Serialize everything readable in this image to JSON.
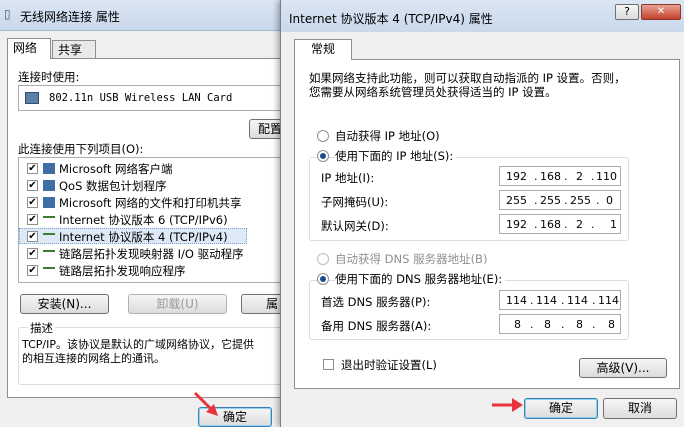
{
  "bg": {
    "title": "无线网络连接 属性",
    "tabs": [
      "网络",
      "共享"
    ],
    "connect_using_label": "连接时使用:",
    "adapter": "802.11n USB Wireless LAN Card",
    "configure_btn": "配置",
    "items_label": "此连接使用下列项目(O):",
    "items": [
      {
        "text": "Microsoft 网络客户端",
        "checked": true
      },
      {
        "text": "QoS 数据包计划程序",
        "checked": true
      },
      {
        "text": "Microsoft 网络的文件和打印机共享",
        "checked": true
      },
      {
        "text": "Internet 协议版本 6 (TCP/IPv6)",
        "checked": true
      },
      {
        "text": "Internet 协议版本 4 (TCP/IPv4)",
        "checked": true
      },
      {
        "text": "链路层拓扑发现映射器 I/O 驱动程序",
        "checked": true
      },
      {
        "text": "链路层拓扑发现响应程序",
        "checked": true
      }
    ],
    "install_btn": "安装(N)...",
    "uninstall_btn": "卸载(U)",
    "props_btn": "属",
    "desc_label": "描述",
    "desc_line1": "TCP/IP。该协议是默认的广域网络协议，它提供",
    "desc_line2": "的相互连接的网络上的通讯。",
    "ok_btn": "确定"
  },
  "fg": {
    "title": "Internet 协议版本 4 (TCP/IPv4) 属性",
    "help_btn": "?",
    "close_btn": "✕",
    "tab": "常规",
    "intro_line1": "如果网络支持此功能，则可以获取自动指派的 IP 设置。否则，",
    "intro_line2": "您需要从网络系统管理员处获得适当的 IP 设置。",
    "auto_ip": "自动获得 IP 地址(O)",
    "manual_ip": "使用下面的 IP 地址(S):",
    "ip_label": "IP 地址(I):",
    "ip": [
      "192",
      "168",
      "2",
      "110"
    ],
    "mask_label": "子网掩码(U):",
    "mask": [
      "255",
      "255",
      "255",
      "0"
    ],
    "gw_label": "默认网关(D):",
    "gw": [
      "192",
      "168",
      "2",
      "1"
    ],
    "auto_dns": "自动获得 DNS 服务器地址(B)",
    "manual_dns": "使用下面的 DNS 服务器地址(E):",
    "dns1_label": "首选 DNS 服务器(P):",
    "dns1": [
      "114",
      "114",
      "114",
      "114"
    ],
    "dns2_label": "备用 DNS 服务器(A):",
    "dns2": [
      "8",
      "8",
      "8",
      "8"
    ],
    "validate_label": "退出时验证设置(L)",
    "advanced_btn": "高级(V)...",
    "ok_btn": "确定",
    "cancel_btn": "取消"
  },
  "colors": {
    "arrow": "#e8323c"
  }
}
